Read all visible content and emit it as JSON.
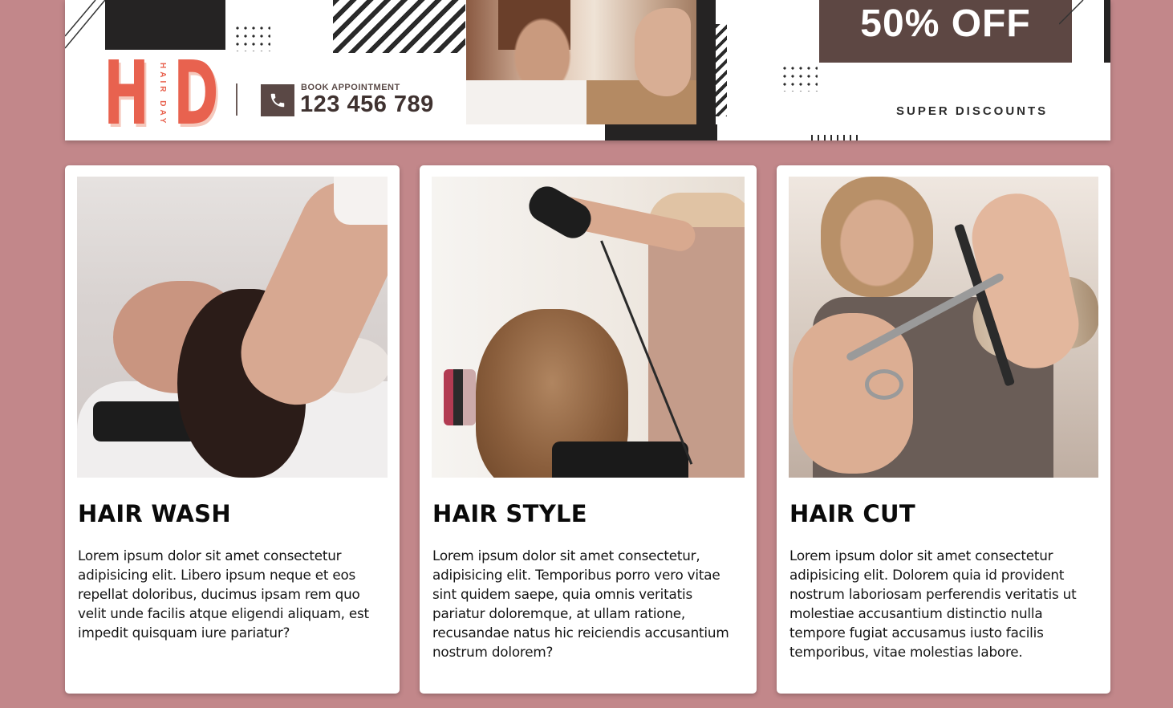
{
  "banner": {
    "logo_left": "H",
    "logo_vertical": "HAIR DAY",
    "logo_right": "D",
    "book_label": "BOOK APPOINTMENT",
    "phone": "123 456 789",
    "offer": "50% OFF",
    "tagline": "SUPER DISCOUNTS",
    "colors": {
      "logo": "#e8624f",
      "offer_box": "#5d4743",
      "page_background": "#c2878a"
    }
  },
  "cards": [
    {
      "title": "HAIR WASH",
      "text": "Lorem ipsum dolor sit amet consectetur adipisicing elit. Libero ipsum neque et eos repellat doloribus, ducimus ipsam rem quo velit unde facilis atque eligendi aliquam, est impedit quisquam iure pariatur?"
    },
    {
      "title": "HAIR STYLE",
      "text": "Lorem ipsum dolor sit amet consectetur, adipisicing elit. Temporibus porro vero vitae sint quidem saepe, quia omnis veritatis pariatur doloremque, at ullam ratione, recusandae natus hic reiciendis accusantium nostrum dolorem?"
    },
    {
      "title": "HAIR CUT",
      "text": "Lorem ipsum dolor sit amet consectetur adipisicing elit. Dolorem quia id provident nostrum laboriosam perferendis veritatis ut molestiae accusantium distinctio nulla tempore fugiat accusamus iusto facilis temporibus, vitae molestias labore."
    }
  ]
}
